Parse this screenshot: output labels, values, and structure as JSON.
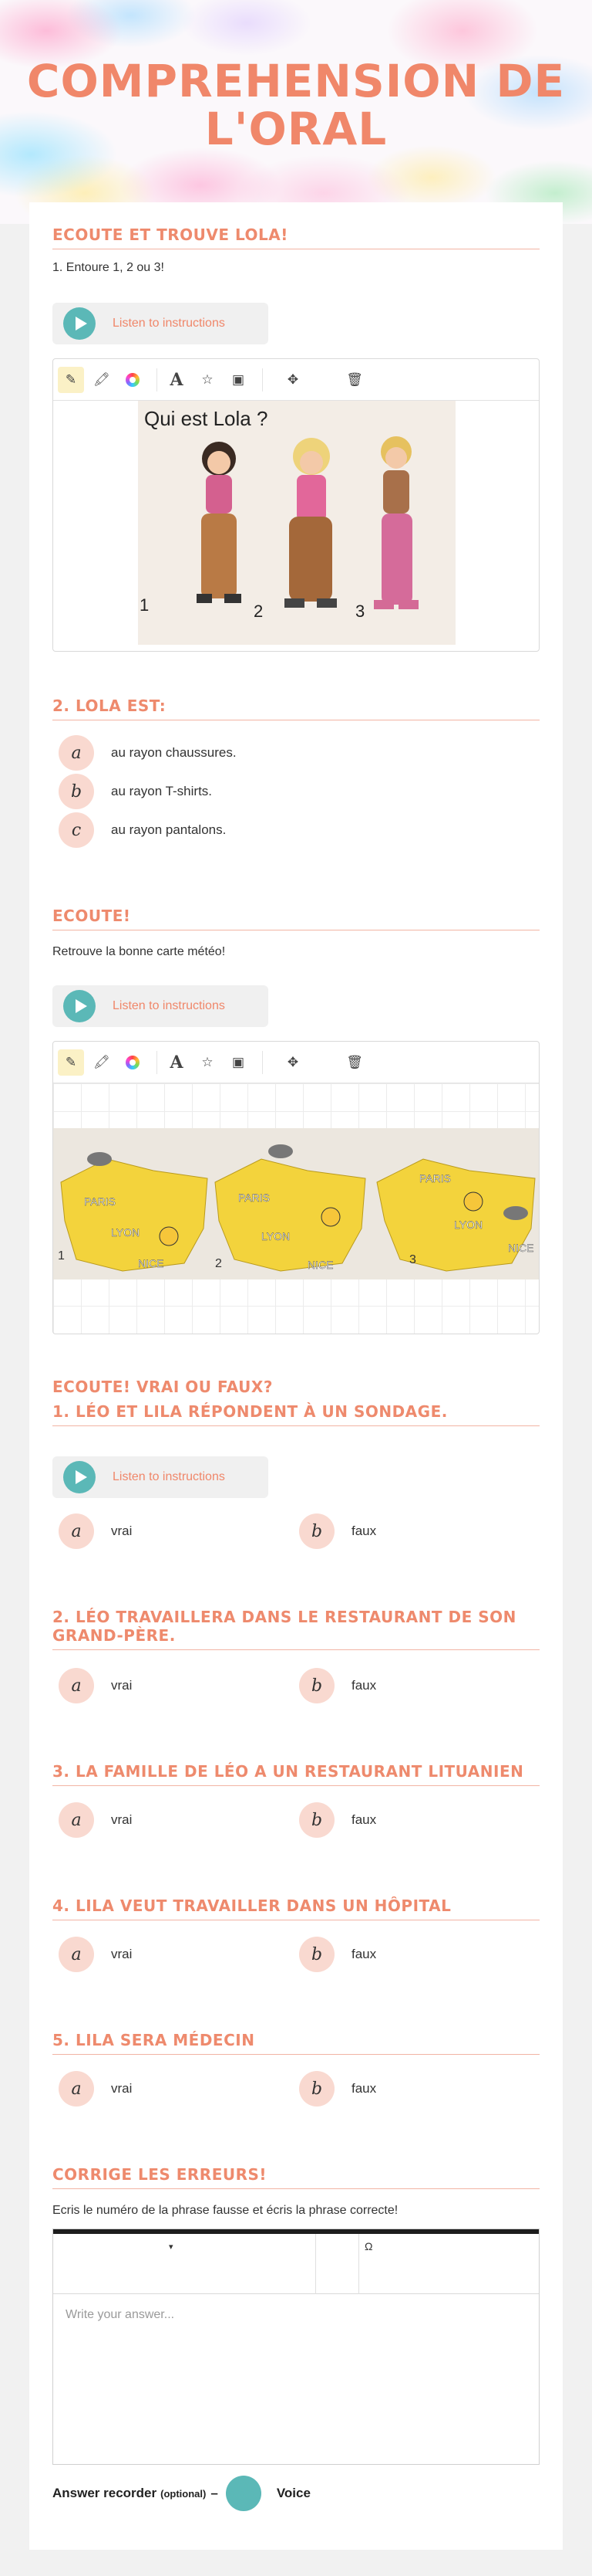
{
  "page_title": "COMPREHENSION DE L'ORAL",
  "toolbar_icons": [
    "pencil-icon",
    "highlighter-icon",
    "color-wheel-icon",
    "text-icon",
    "star-icon",
    "image-icon",
    "move-icon",
    "trash-icon"
  ],
  "colors": {
    "accent": "#ee8a6d",
    "teal": "#5bb8b7",
    "bubble": "#f9d9d0"
  },
  "section1": {
    "title": "ECOUTE ET TROUVE LOLA!",
    "instruction": "1. Entoure 1, 2 ou 3!",
    "listen_label": "Listen to instructions",
    "image_caption": "Qui est Lola ?",
    "figure_numbers": [
      "1",
      "2",
      "3"
    ]
  },
  "section2": {
    "title": "2. LOLA EST:",
    "options": [
      {
        "letter": "a",
        "text": "au rayon chaussures."
      },
      {
        "letter": "b",
        "text": "au rayon T-shirts."
      },
      {
        "letter": "c",
        "text": "au rayon pantalons."
      }
    ]
  },
  "section3": {
    "title": "ECOUTE!",
    "instruction": "Retrouve la bonne carte météo!",
    "listen_label": "Listen to instructions",
    "maps": [
      {
        "number": "1",
        "cities": [
          "PARIS",
          "LYON",
          "NICE"
        ]
      },
      {
        "number": "2",
        "cities": [
          "PARIS",
          "LYON",
          "NICE"
        ]
      },
      {
        "number": "3",
        "cities": [
          "PARIS",
          "LYON",
          "NICE"
        ]
      }
    ]
  },
  "section4": {
    "title_line1": "ECOUTE! VRAI OU FAUX?",
    "title_line2": "1. Léo et Lila répondent à un sondage.",
    "listen_label": "Listen to instructions",
    "options": [
      {
        "letter": "a",
        "text": "vrai"
      },
      {
        "letter": "b",
        "text": "faux"
      }
    ]
  },
  "q2": {
    "title": "2. Léo travaillera dans le restaurant de son grand-père.",
    "options": [
      {
        "letter": "a",
        "text": "vrai"
      },
      {
        "letter": "b",
        "text": "faux"
      }
    ]
  },
  "q3": {
    "title": "3. La famille de Léo a un restaurant lituanien",
    "options": [
      {
        "letter": "a",
        "text": "vrai"
      },
      {
        "letter": "b",
        "text": "faux"
      }
    ]
  },
  "q4": {
    "title": "4. Lila veut travailler dans un hôpital",
    "options": [
      {
        "letter": "a",
        "text": "vrai"
      },
      {
        "letter": "b",
        "text": "faux"
      }
    ]
  },
  "q5": {
    "title": "5. Lila sera médecin",
    "options": [
      {
        "letter": "a",
        "text": "vrai"
      },
      {
        "letter": "b",
        "text": "faux"
      }
    ]
  },
  "section_last": {
    "title": "CORRIGE LES ERREURS!",
    "instruction": "Ecris le numéro de la phrase fausse et écris la phrase correcte!",
    "editor_omega": "Ω",
    "placeholder": "Write your answer...",
    "recorder_label": "Answer recorder",
    "recorder_optional": "(optional)",
    "recorder_dash": "–",
    "voice_label": "Voice"
  }
}
